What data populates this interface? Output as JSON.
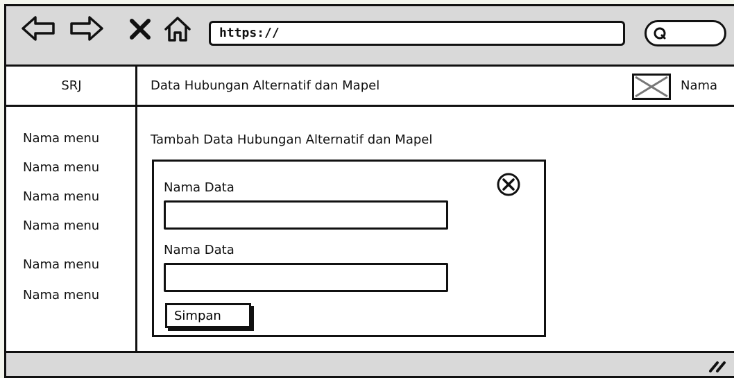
{
  "browser": {
    "url": "https://",
    "back_icon": "arrow-left-icon",
    "forward_icon": "arrow-right-icon",
    "stop_icon": "close-x-icon",
    "home_icon": "home-icon",
    "search_icon": "search-icon"
  },
  "header": {
    "brand": "SRJ",
    "title": "Data Hubungan Alternatif dan Mapel",
    "user_name": "Nama",
    "avatar_icon": "image-placeholder-icon"
  },
  "sidebar": {
    "items": [
      {
        "label": "Nama menu"
      },
      {
        "label": "Nama menu"
      },
      {
        "label": "Nama menu"
      },
      {
        "label": "Nama menu"
      },
      {
        "label": "Nama menu"
      },
      {
        "label": "Nama menu"
      }
    ]
  },
  "main": {
    "heading": "Tambah Data Hubungan Alternatif dan Mapel",
    "form": {
      "close_icon": "close-circle-icon",
      "fields": [
        {
          "label": "Nama Data",
          "value": ""
        },
        {
          "label": "Nama Data",
          "value": ""
        }
      ],
      "submit_label": "Simpan"
    }
  },
  "statusbar": {
    "resize_icon": "resize-grip-icon"
  }
}
